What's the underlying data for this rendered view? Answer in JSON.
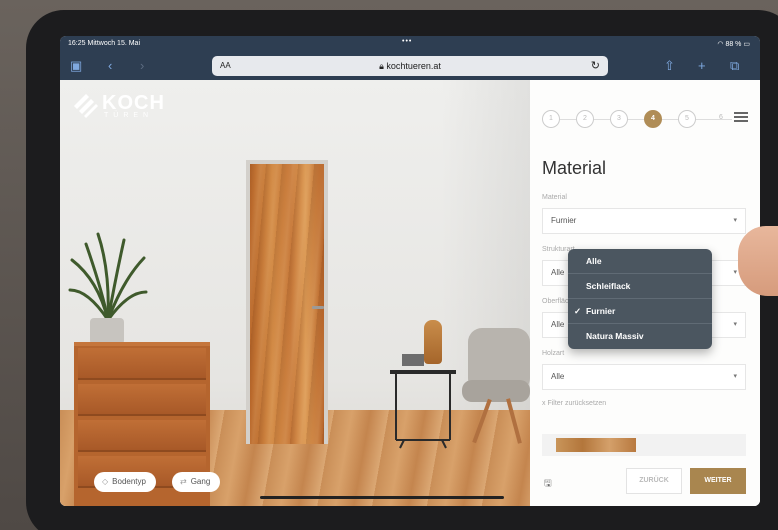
{
  "status": {
    "time": "16:25",
    "date": "Mittwoch 15. Mai",
    "dots": "•••",
    "battery": "88 %"
  },
  "browser": {
    "text_size": "AA",
    "url": "kochtueren.at"
  },
  "logo": {
    "name": "KOCH",
    "sub": "TÜREN"
  },
  "scene": {
    "pills": [
      {
        "label": "Bodentyp"
      },
      {
        "label": "Gang"
      }
    ]
  },
  "panel": {
    "steps": [
      "1",
      "2",
      "3",
      "4",
      "5",
      "6"
    ],
    "active_step": "4",
    "title": "Material",
    "fields": [
      {
        "label": "Material",
        "value": "Furnier"
      },
      {
        "label": "Strukturart",
        "value": "Alle"
      },
      {
        "label": "Oberfläche",
        "value": "Alle"
      },
      {
        "label": "Holzart",
        "value": "Alle"
      }
    ],
    "reset": "x Filter zurücksetzen",
    "back": "ZURÜCK",
    "next": "WEITER"
  },
  "dropdown": {
    "options": [
      {
        "label": "Alle",
        "checked": false
      },
      {
        "label": "Schleiflack",
        "checked": false
      },
      {
        "label": "Furnier",
        "checked": true
      },
      {
        "label": "Natura Massiv",
        "checked": false
      }
    ],
    "check": "✓"
  },
  "colors": {
    "accent": "#a9864f",
    "toolbar": "#2e3e52",
    "dropdown": "#4b5660"
  }
}
